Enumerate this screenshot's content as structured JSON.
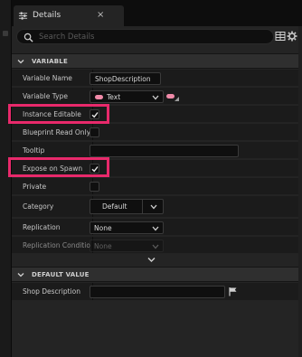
{
  "tab": {
    "title": "Details",
    "close": "×",
    "icon": "details-sliders-icon"
  },
  "search": {
    "placeholder": "Search Details"
  },
  "toolbar": {
    "grid_icon": "property-matrix-icon",
    "settings_icon": "gear-icon"
  },
  "sections": {
    "variable": "VARIABLE",
    "default_value": "DEFAULT VALUE"
  },
  "rows": {
    "variable_name": {
      "label": "Variable Name",
      "value": "ShopDescription"
    },
    "variable_type": {
      "label": "Variable Type",
      "value": "Text",
      "type_color": "#f08aa8"
    },
    "instance_editable": {
      "label": "Instance Editable",
      "checked": true
    },
    "blueprint_read_only": {
      "label": "Blueprint Read Only",
      "checked": false
    },
    "tooltip": {
      "label": "Tooltip",
      "value": ""
    },
    "expose_on_spawn": {
      "label": "Expose on Spawn",
      "checked": true
    },
    "private": {
      "label": "Private",
      "checked": false
    },
    "category": {
      "label": "Category",
      "value": "Default"
    },
    "replication": {
      "label": "Replication",
      "value": "None"
    },
    "replication_condition": {
      "label": "Replication Conditio",
      "value": "None"
    },
    "shop_description": {
      "label": "Shop Description",
      "value": ""
    }
  },
  "colors": {
    "highlight": "#e8296b",
    "accent": "#f08aa8"
  }
}
